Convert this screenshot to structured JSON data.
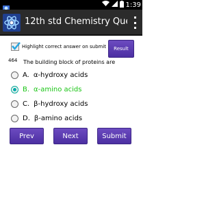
{
  "status_bar": {
    "time": "1:39",
    "icons": [
      "app-notification-icon",
      "wifi-icon",
      "signal-icon",
      "battery-icon"
    ]
  },
  "action_bar": {
    "title": "12th std Chemistry Que...",
    "app_icon": "atom-icon",
    "menu_icon": "overflow-menu-icon"
  },
  "quiz": {
    "highlight_label": "Highlight correct answer on submit",
    "highlight_checked": true,
    "result_label": "Result",
    "question_number": "464",
    "question_text": "The building block of proteins are",
    "options": [
      {
        "letter": "A.",
        "text": "α-hydroxy acids",
        "selected": false,
        "correct": false
      },
      {
        "letter": "B.",
        "text": "α-amino acids",
        "selected": true,
        "correct": true
      },
      {
        "letter": "C.",
        "text": "β-hydroxy acids",
        "selected": false,
        "correct": false
      },
      {
        "letter": "D.",
        "text": "β-amino acids",
        "selected": false,
        "correct": false
      }
    ],
    "prev_label": "Prev",
    "next_label": "Next",
    "submit_label": "Submit"
  },
  "colors": {
    "button_purple": "#5a3bb3",
    "correct_green": "#19c414",
    "action_bar": "#2b2b2b"
  }
}
